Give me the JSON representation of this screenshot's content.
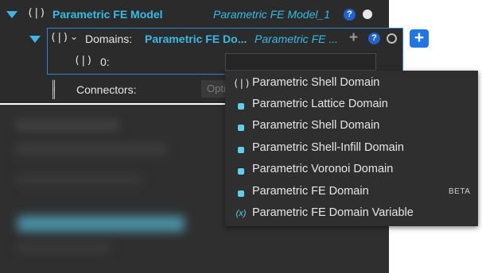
{
  "model": {
    "title": "Parametric FE Model",
    "name": "Parametric FE Model_1",
    "help": "?"
  },
  "domains": {
    "label": "Domains:",
    "value": "Parametric FE Do...",
    "name": "Parametric FE ...",
    "help": "?",
    "add": "+",
    "add_button": "+",
    "item_label": "0:"
  },
  "connectors": {
    "label": "Connectors:",
    "field_text": "Opti"
  },
  "menu": {
    "items": [
      {
        "label": "Parametric Shell Domain",
        "icon": "shell-icon"
      },
      {
        "label": "Parametric Lattice Domain",
        "icon": "square-icon"
      },
      {
        "label": "Parametric Shell Domain",
        "icon": "square-icon"
      },
      {
        "label": "Parametric Shell-Infill Domain",
        "icon": "square-icon"
      },
      {
        "label": "Parametric Voronoi Domain",
        "icon": "square-icon"
      },
      {
        "label": "Parametric FE Domain",
        "icon": "square-icon",
        "badge": "BETA"
      },
      {
        "label": "Parametric FE Domain Variable",
        "icon": "variable-icon",
        "icon_text": "(x)"
      }
    ]
  },
  "colors": {
    "accent": "#33bde6",
    "panel": "#2b2b2b",
    "menu": "#2f2f2f",
    "selection_border": "#2a87d8",
    "button": "#1e74e8"
  }
}
